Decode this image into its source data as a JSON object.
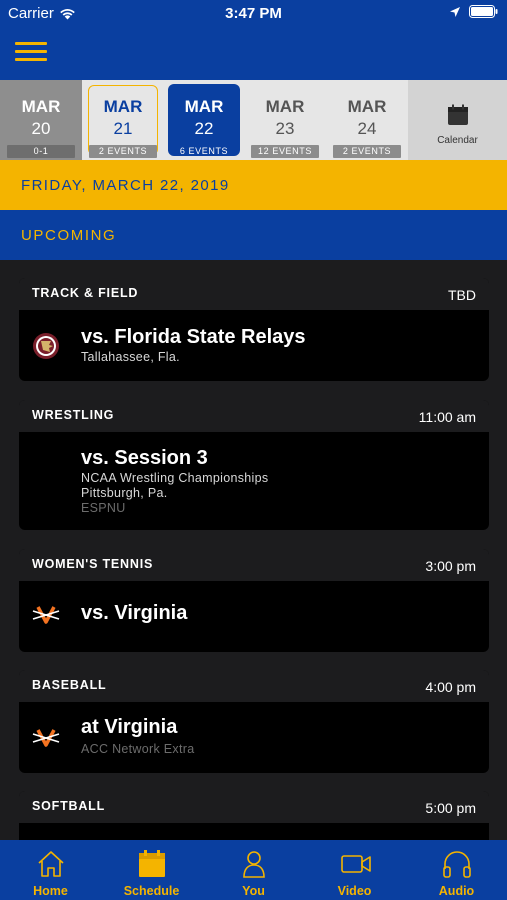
{
  "status_bar": {
    "carrier": "Carrier",
    "time": "3:47 PM"
  },
  "date_strip": {
    "days": [
      {
        "month": "MAR",
        "day": "20",
        "badge": "0-1",
        "state": "past"
      },
      {
        "month": "MAR",
        "day": "21",
        "badge": "2 EVENTS",
        "state": "outlined"
      },
      {
        "month": "MAR",
        "day": "22",
        "badge": "6 EVENTS",
        "state": "selected"
      },
      {
        "month": "MAR",
        "day": "23",
        "badge": "12 EVENTS",
        "state": "normal"
      },
      {
        "month": "MAR",
        "day": "24",
        "badge": "2 EVENTS",
        "state": "normal"
      }
    ],
    "calendar_label": "Calendar"
  },
  "selected_date": "FRIDAY, MARCH 22, 2019",
  "section_title": "UPCOMING",
  "events": [
    {
      "sport": "TRACK & FIELD",
      "time": "TBD",
      "opponent": "vs. Florida State Relays",
      "line1": "Tallahassee, Fla.",
      "line2": "",
      "tv": "",
      "logo": "fsu-logo-icon"
    },
    {
      "sport": "WRESTLING",
      "time": "11:00 am",
      "opponent": "vs. Session 3",
      "line1": "NCAA Wrestling Championships",
      "line2": "Pittsburgh, Pa.",
      "tv": "ESPNU",
      "logo": ""
    },
    {
      "sport": "WOMEN'S TENNIS",
      "time": "3:00 pm",
      "opponent": "vs. Virginia",
      "line1": "",
      "line2": "",
      "tv": "",
      "logo": "virginia-logo-icon"
    },
    {
      "sport": "BASEBALL",
      "time": "4:00 pm",
      "opponent": "at Virginia",
      "line1": "",
      "line2": "",
      "tv": "ACC Network Extra",
      "logo": "virginia-logo-icon"
    },
    {
      "sport": "SOFTBALL",
      "time": "5:00 pm",
      "opponent": "",
      "line1": "",
      "line2": "",
      "tv": "",
      "logo": ""
    }
  ],
  "tabs": [
    {
      "label": "Home",
      "icon": "home-icon"
    },
    {
      "label": "Schedule",
      "icon": "calendar-icon"
    },
    {
      "label": "You",
      "icon": "person-icon"
    },
    {
      "label": "Video",
      "icon": "video-camera-icon"
    },
    {
      "label": "Audio",
      "icon": "headphones-icon"
    }
  ],
  "colors": {
    "primary": "#0a3fa0",
    "accent": "#f4b400",
    "background": "#1c1c1e",
    "card": "#000000"
  }
}
